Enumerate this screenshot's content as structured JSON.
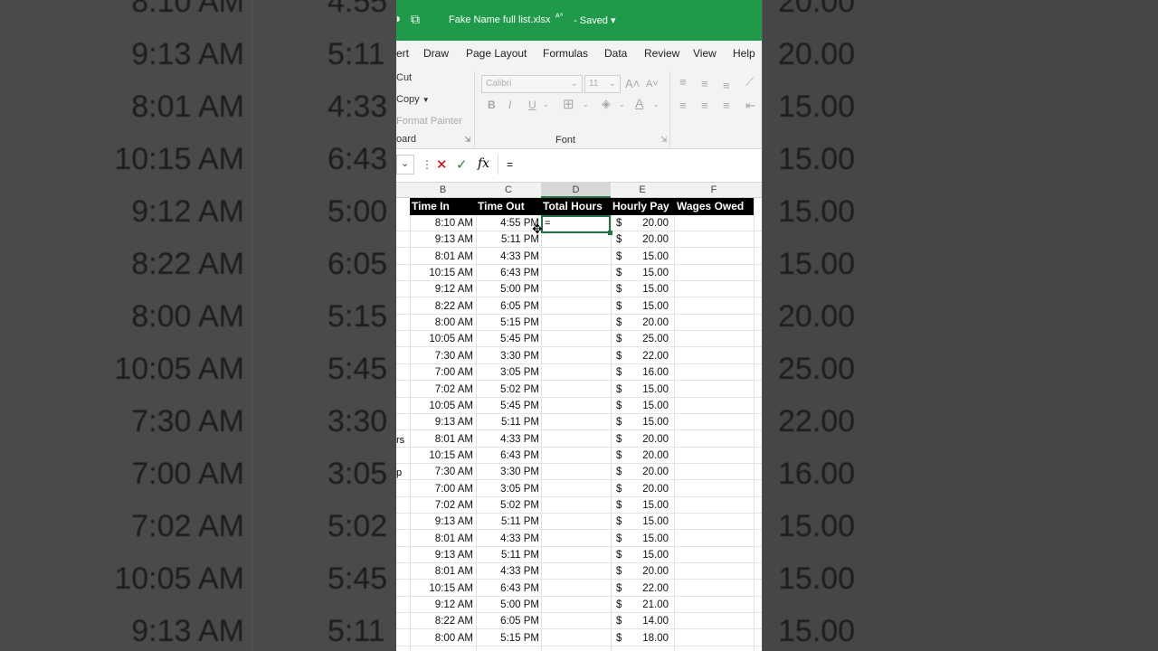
{
  "app": {
    "filename": "Fake Name full list.xlsx",
    "saved_status": "Saved"
  },
  "menu": [
    "ert",
    "Draw",
    "Page Layout",
    "Formulas",
    "Data",
    "Review",
    "View",
    "Help"
  ],
  "ribbon": {
    "cut_label": "Cut",
    "copy_label": "Copy",
    "format_painter_label": "Format Painter",
    "clipboard_group": "oard",
    "font_name": "Calibri",
    "font_size": "11",
    "font_group": "Font"
  },
  "formula_bar": {
    "content": "="
  },
  "columns": [
    "B",
    "C",
    "D",
    "E",
    "F"
  ],
  "headers": {
    "time_in": "Time In",
    "time_out": "Time Out",
    "total_hours": "Total Hours",
    "hourly_pay": "Hourly Pay",
    "wages_owed": "Wages Owed"
  },
  "edit_cell_value": "=",
  "row_labels_partial": {
    "rs": "rs",
    "p": "p"
  },
  "rows": [
    {
      "in": "8:10 AM",
      "out": "4:55 PM",
      "cur": "$",
      "pay": "20.00"
    },
    {
      "in": "9:13 AM",
      "out": "5:11 PM",
      "cur": "$",
      "pay": "20.00"
    },
    {
      "in": "8:01 AM",
      "out": "4:33 PM",
      "cur": "$",
      "pay": "15.00"
    },
    {
      "in": "10:15 AM",
      "out": "6:43 PM",
      "cur": "$",
      "pay": "15.00"
    },
    {
      "in": "9:12 AM",
      "out": "5:00 PM",
      "cur": "$",
      "pay": "15.00"
    },
    {
      "in": "8:22 AM",
      "out": "6:05 PM",
      "cur": "$",
      "pay": "15.00"
    },
    {
      "in": "8:00 AM",
      "out": "5:15 PM",
      "cur": "$",
      "pay": "20.00"
    },
    {
      "in": "10:05 AM",
      "out": "5:45 PM",
      "cur": "$",
      "pay": "25.00"
    },
    {
      "in": "7:30 AM",
      "out": "3:30 PM",
      "cur": "$",
      "pay": "22.00"
    },
    {
      "in": "7:00 AM",
      "out": "3:05 PM",
      "cur": "$",
      "pay": "16.00"
    },
    {
      "in": "7:02 AM",
      "out": "5:02 PM",
      "cur": "$",
      "pay": "15.00"
    },
    {
      "in": "10:05 AM",
      "out": "5:45 PM",
      "cur": "$",
      "pay": "15.00"
    },
    {
      "in": "9:13 AM",
      "out": "5:11 PM",
      "cur": "$",
      "pay": "15.00"
    },
    {
      "in": "8:01 AM",
      "out": "4:33 PM",
      "cur": "$",
      "pay": "20.00"
    },
    {
      "in": "10:15 AM",
      "out": "6:43 PM",
      "cur": "$",
      "pay": "20.00"
    },
    {
      "in": "7:30 AM",
      "out": "3:30 PM",
      "cur": "$",
      "pay": "20.00"
    },
    {
      "in": "7:00 AM",
      "out": "3:05 PM",
      "cur": "$",
      "pay": "20.00"
    },
    {
      "in": "7:02 AM",
      "out": "5:02 PM",
      "cur": "$",
      "pay": "15.00"
    },
    {
      "in": "9:13 AM",
      "out": "5:11 PM",
      "cur": "$",
      "pay": "15.00"
    },
    {
      "in": "8:01 AM",
      "out": "4:33 PM",
      "cur": "$",
      "pay": "15.00"
    },
    {
      "in": "9:13 AM",
      "out": "5:11 PM",
      "cur": "$",
      "pay": "15.00"
    },
    {
      "in": "8:01 AM",
      "out": "4:33 PM",
      "cur": "$",
      "pay": "20.00"
    },
    {
      "in": "10:15 AM",
      "out": "6:43 PM",
      "cur": "$",
      "pay": "22.00"
    },
    {
      "in": "9:12 AM",
      "out": "5:00 PM",
      "cur": "$",
      "pay": "21.00"
    },
    {
      "in": "8:22 AM",
      "out": "6:05 PM",
      "cur": "$",
      "pay": "14.00"
    },
    {
      "in": "8:00 AM",
      "out": "5:15 PM",
      "cur": "$",
      "pay": "18.00"
    }
  ],
  "background_left": [
    {
      "in": "8:10 AM",
      "out": "4:55"
    },
    {
      "in": "9:13 AM",
      "out": "5:11"
    },
    {
      "in": "8:01 AM",
      "out": "4:33"
    },
    {
      "in": "10:15 AM",
      "out": "6:43"
    },
    {
      "in": "9:12 AM",
      "out": "5:00"
    },
    {
      "in": "8:22 AM",
      "out": "6:05"
    },
    {
      "in": "8:00 AM",
      "out": "5:15"
    },
    {
      "in": "10:05 AM",
      "out": "5:45"
    },
    {
      "in": "7:30 AM",
      "out": "3:30"
    },
    {
      "in": "7:00 AM",
      "out": "3:05"
    },
    {
      "in": "7:02 AM",
      "out": "5:02"
    },
    {
      "in": "10:05 AM",
      "out": "5:45"
    },
    {
      "in": "9:13 AM",
      "out": "5:11"
    }
  ],
  "background_right": [
    "20.00",
    "20.00",
    "15.00",
    "15.00",
    "15.00",
    "15.00",
    "20.00",
    "25.00",
    "22.00",
    "16.00",
    "15.00",
    "15.00",
    "15.00"
  ],
  "colors": {
    "title_green": "#1f9a4a",
    "selection_green": "#217346",
    "header_black": "#000000"
  }
}
